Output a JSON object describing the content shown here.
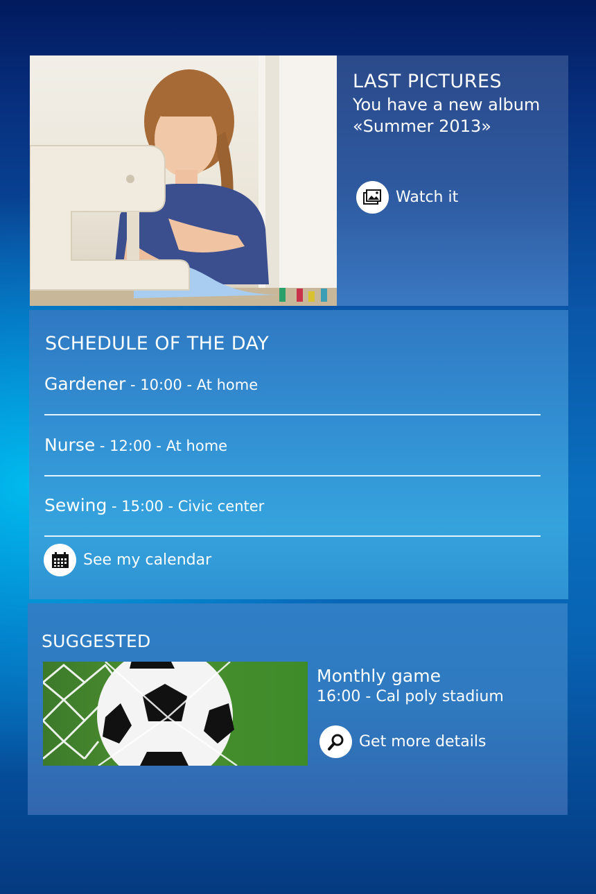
{
  "colors": {
    "background_top": "#021a5e",
    "background_glow": "#00bef0",
    "panel_pictures": "#2e5aa0",
    "panel_schedule": "#3392d4",
    "panel_suggested": "#2f79bf",
    "text": "#ffffff"
  },
  "last_pictures": {
    "title": "LAST PICTURES",
    "subtitle_line1": "You have a new album",
    "subtitle_line2": "«Summer 2013»",
    "action_label": "Watch it",
    "action_icon": "photo-album-icon"
  },
  "schedule": {
    "title": "SCHEDULE OF THE DAY",
    "items": [
      {
        "name": "Gardener",
        "time": "10:00",
        "place": "At home"
      },
      {
        "name": "Nurse",
        "time": "12:00",
        "place": "At home"
      },
      {
        "name": "Sewing",
        "time": "15:00",
        "place": "Civic center"
      }
    ],
    "separator": " - ",
    "action_label": "See my calendar",
    "action_icon": "calendar-icon"
  },
  "suggested": {
    "title": "SUGGESTED",
    "event_name": "Monthly game",
    "event_when": "16:00 - Cal poly stadium",
    "action_label": "Get more details",
    "action_icon": "magnifier-icon"
  }
}
